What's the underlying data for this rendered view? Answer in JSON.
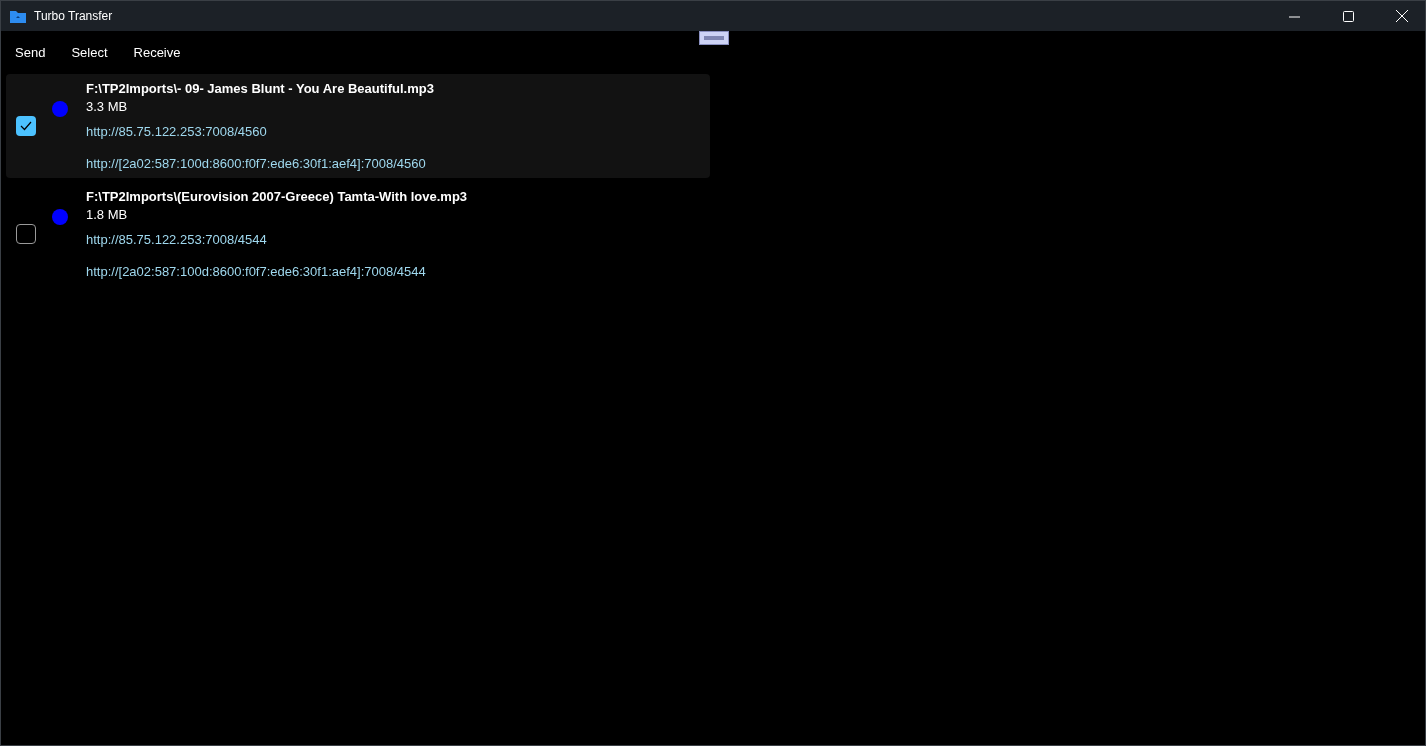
{
  "window": {
    "title": "Turbo Transfer"
  },
  "menu": [
    "Send",
    "Select",
    "Receive"
  ],
  "files": [
    {
      "path": "F:\\TP2Imports\\- 09- James Blunt - You Are Beautiful.mp3",
      "size": "3.3 MB",
      "links": [
        "http://85.75.122.253:7008/4560",
        "http://[2a02:587:100d:8600:f0f7:ede6:30f1:aef4]:7008/4560"
      ],
      "checked": true,
      "selected": true,
      "color": "#0000ff"
    },
    {
      "path": "F:\\TP2Imports\\(Eurovision 2007-Greece) Tamta-With love.mp3",
      "size": "1.8 MB",
      "links": [
        "http://85.75.122.253:7008/4544",
        "http://[2a02:587:100d:8600:f0f7:ede6:30f1:aef4]:7008/4544"
      ],
      "checked": false,
      "selected": false,
      "color": "#0000ff"
    }
  ]
}
